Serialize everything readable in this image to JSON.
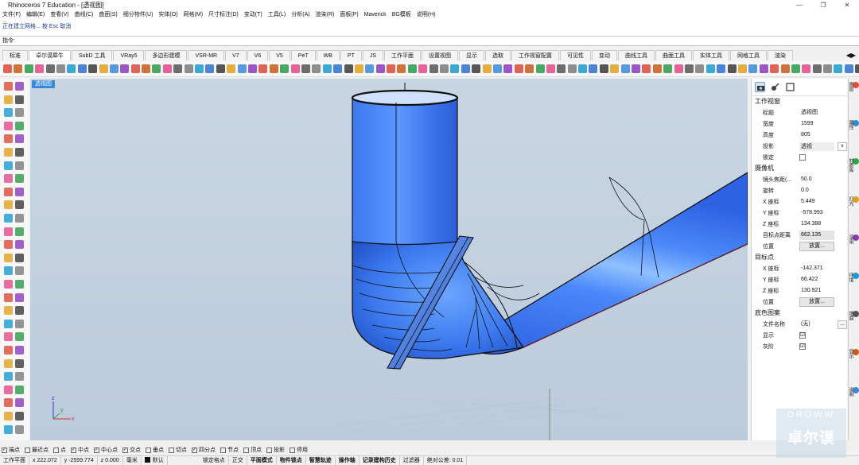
{
  "window": {
    "title": "Rhinoceros 7 Education - [透视图]",
    "controls": [
      "—",
      "❐",
      "✕"
    ]
  },
  "menu": [
    "文件(F)",
    "编辑(E)",
    "查看(V)",
    "曲线(C)",
    "曲面(S)",
    "细分物件(U)",
    "实体(O)",
    "网格(M)",
    "尺寸标注(D)",
    "变动(T)",
    "工具(L)",
    "分析(A)",
    "渲染(R)",
    "面板(P)",
    "Maverick",
    "BG模板",
    "说明(H)"
  ],
  "command_history": {
    "line1": "...",
    "line2": "正在建立网格... 按 Esc 取消",
    "prompt": "指令:"
  },
  "tabs": {
    "items": [
      "标准",
      "卓尔谟犀牛",
      "SubD 工具",
      "VRay5",
      "多边形建模",
      "VSR-MR",
      "V7",
      "V6",
      "V5",
      "PeT",
      "WB",
      "PT",
      "JS",
      "工作平面",
      "设置视图",
      "显示",
      "选取",
      "工作视窗配置",
      "可见性",
      "变动",
      "曲线工具",
      "曲面工具",
      "实体工具",
      "网格工具",
      "渲染"
    ],
    "active_index": 1,
    "nav": "◀▶"
  },
  "viewport": {
    "label": "透视图",
    "axis_x": "x",
    "axis_y": "y",
    "axis_z": "z",
    "colors": {
      "background_top": "#c7d5e3",
      "background_bottom": "#bfcede",
      "surface_dark": "#2a5fe0",
      "surface_mid": "#3e7cf2",
      "surface_light": "#7fb6ff",
      "edge": "#111111"
    }
  },
  "properties_panel": {
    "section_viewport": "工作视窗",
    "title_label": "标题",
    "title_value": "透视图",
    "width_label": "宽度",
    "width_value": "1599",
    "height_label": "高度",
    "height_value": "805",
    "projection_label": "投影",
    "projection_value": "透视",
    "lock_label": "锁定",
    "section_camera": "摄像机",
    "lens_label": "镜头焦距(...",
    "lens_value": "50.0",
    "rotation_label": "旋转",
    "rotation_value": "0.0",
    "camx_label": "X 座标",
    "camx_value": "5.449",
    "camy_label": "Y 座标",
    "camy_value": "-578.993",
    "camz_label": "Z 座标",
    "camz_value": "134.388",
    "targetdist_label": "目标点距离",
    "targetdist_value": "662.135",
    "cam_pos_label": "位置",
    "cam_place_button": "放置...",
    "section_target": "目标点",
    "tx_label": "X 座标",
    "tx_value": "-142.371",
    "ty_label": "Y 座标",
    "ty_value": "66.422",
    "tz_label": "Z 座标",
    "tz_value": "130.921",
    "target_pos_label": "位置",
    "target_place_button": "放置...",
    "section_bg": "底色图案",
    "filename_label": "文件名称",
    "filename_value": "(无)",
    "show_label": "显示",
    "gray_label": "灰阶",
    "check": "☑",
    "dots": "...",
    "dropdown": "∨"
  },
  "right_sidebar": [
    "图层",
    "属性",
    "材质库",
    "灯光",
    "渲染",
    "环境",
    "地面",
    "显示",
    "说明"
  ],
  "osnap": {
    "items": [
      "端点",
      "最近点",
      "点",
      "中点",
      "中心点",
      "交点",
      "垂点",
      "切点",
      "四分点",
      "节点",
      "顶点",
      "投影",
      "停用"
    ],
    "checked": [
      true,
      false,
      false,
      true,
      true,
      true,
      false,
      false,
      true,
      false,
      false,
      false,
      false
    ]
  },
  "status": {
    "cplane": "工作平面",
    "x": "x 222.072",
    "y": "y -2599.774",
    "z": "z 0.000",
    "unit": "毫米",
    "layer": "默认",
    "items": [
      "锁定格点",
      "正交",
      "平面模式",
      "物件锁点",
      "智慧轨迹",
      "操作轴",
      "记录建构历史",
      "过滤器",
      "绝对公差: 0.01"
    ]
  },
  "watermark": {
    "line1": "DROWW",
    "line2": "卓尔谟"
  }
}
